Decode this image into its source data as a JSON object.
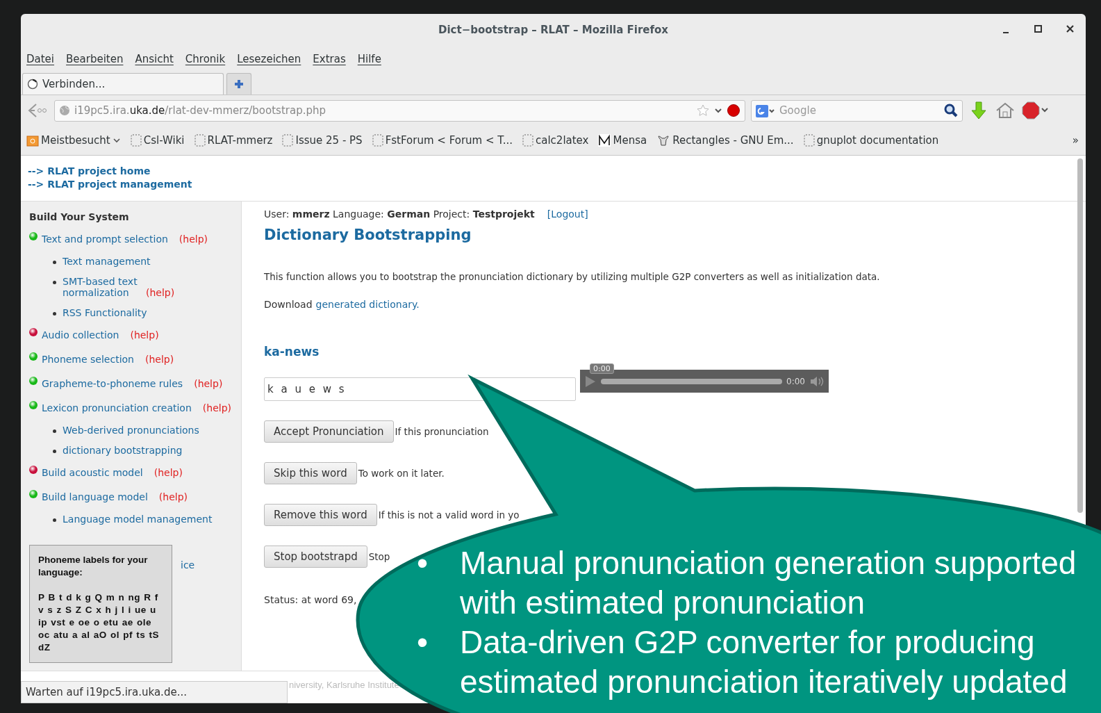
{
  "window": {
    "title": "Dict−bootstrap – RLAT – Mozilla Firefox"
  },
  "menu": [
    "Datei",
    "Bearbeiten",
    "Ansicht",
    "Chronik",
    "Lesezeichen",
    "Extras",
    "Hilfe"
  ],
  "tabs": [
    {
      "label": "Verbinden...",
      "selected": true
    }
  ],
  "address_bar": {
    "host_start": "i19pc5.ira.",
    "host_domain": "uka.de",
    "path": "/rlat-dev-mmerz/bootstrap.php"
  },
  "search": {
    "placeholder": "Google"
  },
  "bookmarks": [
    {
      "label": "Meistbesucht",
      "kind": "folder"
    },
    {
      "label": "Csl-Wiki",
      "kind": "page"
    },
    {
      "label": "RLAT-mmerz",
      "kind": "page"
    },
    {
      "label": "Issue 25 - PS",
      "kind": "page"
    },
    {
      "label": "FstForum < Forum < T...",
      "kind": "page"
    },
    {
      "label": "calc2latex",
      "kind": "page"
    },
    {
      "label": "Mensa",
      "kind": "mensa"
    },
    {
      "label": "Rectangles - GNU Em...",
      "kind": "gnu"
    },
    {
      "label": "gnuplot documentation",
      "kind": "page"
    }
  ],
  "bookmarks_more": "»",
  "top_links": [
    "--> RLAT project home",
    "--> RLAT project management"
  ],
  "sidebar": {
    "title": "Build Your System",
    "items": [
      {
        "label": "Text and prompt selection",
        "help": "(help)",
        "color": "#17b817",
        "children": [
          {
            "label": "Text management"
          },
          {
            "label": "SMT-based text normalization",
            "help": "(help)"
          },
          {
            "label": "RSS Functionality"
          }
        ]
      },
      {
        "label": "Audio collection",
        "help": "(help)",
        "color": "#c8103c"
      },
      {
        "label": "Phoneme selection",
        "help": "(help)",
        "color": "#17b817"
      },
      {
        "label": "Grapheme-to-phoneme rules",
        "help": "(help)",
        "color": "#17b817"
      },
      {
        "label": "Lexicon pronunciation creation",
        "help": "(help)",
        "color": "#17b817",
        "children": [
          {
            "label": "Web-derived pronunciations"
          },
          {
            "label": "dictionary bootstrapping"
          }
        ]
      },
      {
        "label": "Build acoustic model",
        "help": "(help)",
        "color": "#c8103c"
      },
      {
        "label": "Build language model",
        "help": "(help)",
        "color": "#17b817",
        "children": [
          {
            "label": "Language model management"
          },
          {
            "label": "ice",
            "kind": "covered"
          }
        ]
      }
    ]
  },
  "phoneme_box": {
    "title": "Phoneme labels for your language:",
    "labels": "P B t d k g Q m n ng R f v s z S Z C x h j l i ue u ip vst e oe o etu ae ole oc atu a al aO ol pf ts tS dZ"
  },
  "main": {
    "user_line": "User: **mmerz** Language: **German** Project: **Testprojekt**",
    "logout": "[Logout]",
    "heading": "Dictionary Bootstrapping",
    "description": "This function allows you to bootstrap the pronunciation dictionary by utilizing multiple G2P converters as well as initialization data.",
    "download_text": "Download",
    "download_link": "generated dictionary.",
    "word_title": "ka-news",
    "pronunciation": "k a u e w s",
    "player": {
      "tooltip": "0:00",
      "time": "0:00"
    },
    "actions": [
      {
        "button": "Accept Pronunciation",
        "note": "If this pronunciation"
      },
      {
        "button": "Skip this word",
        "note": "To work on it later."
      },
      {
        "button": "Remove this word",
        "note": "If this is not a valid word in yo"
      },
      {
        "button": "Stop bootstrapd",
        "note": "Stop"
      }
    ],
    "status": "Status: at word 69,"
  },
  "footer": "niversity, Karlsruhe Institute",
  "status_bar": "Warten auf i19pc5.ira.uka.de...",
  "callout": {
    "bullets": [
      {
        "marker": "•",
        "text": "Manual pronunciation generation supported with estimated pronunciation"
      },
      {
        "marker": "•",
        "text": "Data-driven G2P converter for producing estimated pronunciation iteratively updated"
      }
    ]
  }
}
